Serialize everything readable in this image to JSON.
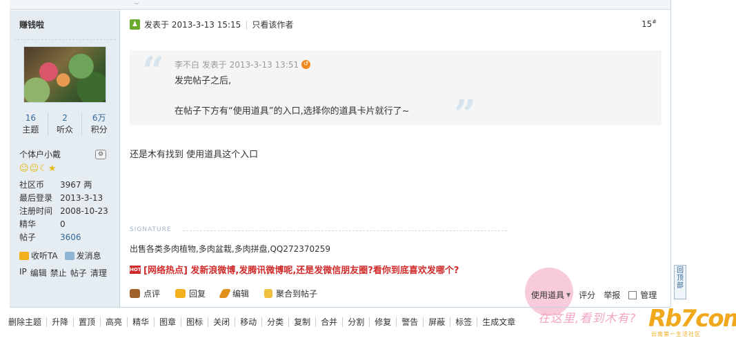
{
  "sidebar": {
    "username": "赚钱啦",
    "stats": [
      {
        "value": "16",
        "label": "主题"
      },
      {
        "value": "2",
        "label": "听众"
      },
      {
        "value": "6万",
        "label": "积分"
      }
    ],
    "rank": "个体户小戴",
    "info": [
      {
        "key": "社区币",
        "value": "3967 两"
      },
      {
        "key": "最后登录",
        "value": "2013-3-13"
      },
      {
        "key": "注册时间",
        "value": "2008-10-23"
      },
      {
        "key": "精华",
        "value": "0"
      },
      {
        "key": "帖子",
        "value": "3606"
      }
    ],
    "follow": "收听TA",
    "message": "发消息",
    "admin_links": [
      "IP",
      "编辑",
      "禁止",
      "帖子",
      "清理"
    ]
  },
  "post": {
    "posted_at": "发表于 2013-3-13 15:15",
    "only_author": "只看该作者",
    "floor": "15",
    "floor_mark": "#",
    "quote": {
      "meta": "李不白 发表于 2013-3-13 13:51",
      "line1": "发完帖子之后,",
      "line2": "在帖子下方有“使用道具”的入口,选择你的道具卡片就行了~"
    },
    "reply": "还是木有找到 使用道具这个入口",
    "signature_label": "SIGNATURE",
    "signature": "出售各类多肉植物,多肉盆栽,多肉拼盘,QQ272370259",
    "hot_badge": "HOT",
    "hot_text": "[网络热点] 发新浪微博,发腾讯微博呢,还是发微信朋友圈?看你到底喜欢发哪个?",
    "actions": [
      {
        "label": "点评",
        "color": "#a0612a"
      },
      {
        "label": "回复",
        "color": "#f2b01e"
      },
      {
        "label": "编辑",
        "color": "#e0901a"
      },
      {
        "label": "聚合到帖子",
        "color": "#f0c040"
      }
    ],
    "use_tool": "使用道具",
    "rate": "评分",
    "report": "举报",
    "manage": "管理"
  },
  "back_to_top": "回顶部",
  "mod_actions": [
    "删除主题",
    "升降",
    "置顶",
    "高亮",
    "精华",
    "图章",
    "图标",
    "关闭",
    "移动",
    "分类",
    "复制",
    "合并",
    "分割",
    "修复",
    "警告",
    "屏蔽",
    "标签",
    "生成文章"
  ],
  "annotation": "在这里,看到木有?",
  "watermark": "Rb7com",
  "watermark_sub": "云南第一生活社区"
}
